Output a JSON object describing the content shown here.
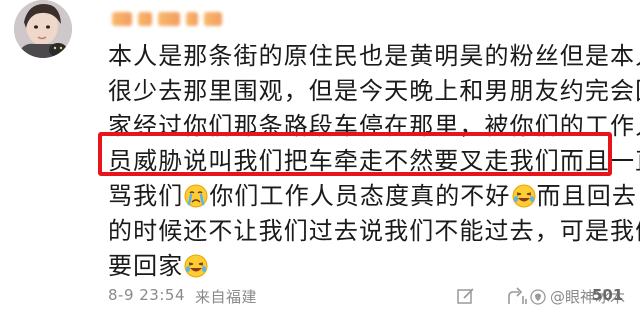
{
  "post": {
    "lines": [
      "本人是那条街的原住民也是黄明昊的粉丝但是本人",
      "很少去那里围观，但是今天晚上和男朋友约完会回",
      "家经过你们那条路段车停在那里，被你们的工作人",
      "员威胁说叫我们把车牵走不然要叉走我们而且一直",
      "骂我们",
      "你们工作人员态度真的不好",
      "而且回去",
      "的时候还不让我们过去说我们不能过去，可是我们",
      "要回家"
    ],
    "emoji_names": [
      "crying-face-icon",
      "laughing-crying-face-icon",
      "laughing-crying-face-icon"
    ],
    "highlight_color": "#e8141c"
  },
  "meta": {
    "date": "8-9 23:54",
    "source": "来自福建"
  },
  "actions": {
    "like_count": "501",
    "watermark": "@眼神冰木"
  }
}
